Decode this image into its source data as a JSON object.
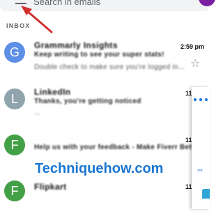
{
  "search": {
    "placeholder": "Search in emails"
  },
  "inbox_label": "INBOX",
  "emails": [
    {
      "avatar": "G",
      "avatar_color": "#5c8fe6",
      "sender": "Grammarly Insights",
      "time": "2:59 pm",
      "subject": "Keep writing to see your super stats!",
      "snippet": "Double check to make sure you're logged in..."
    },
    {
      "avatar": "L",
      "avatar_color": "#90a4ae",
      "sender": "LinkedIn",
      "time": "11",
      "subject": "Thanks, you're getting noticed",
      "snippet": "..."
    },
    {
      "avatar": "F",
      "avatar_color": "#43a047",
      "sender": "",
      "time": "11",
      "subject": "Help us with your feedback - Make Fiverr Better",
      "snippet": ""
    },
    {
      "avatar": "F",
      "avatar_color": "#43a047",
      "sender": "Flipkart",
      "time": "11",
      "subject": "",
      "snippet": ""
    }
  ],
  "watermark": "Techniquehow.com",
  "icons": {
    "menu": "hamburger-menu-icon",
    "star": "star-outline-icon",
    "side_tool": "translate-icon"
  },
  "colors": {
    "accent": "#1976d2",
    "annotation": "#d32f2f",
    "account": "#7b1fa2"
  }
}
